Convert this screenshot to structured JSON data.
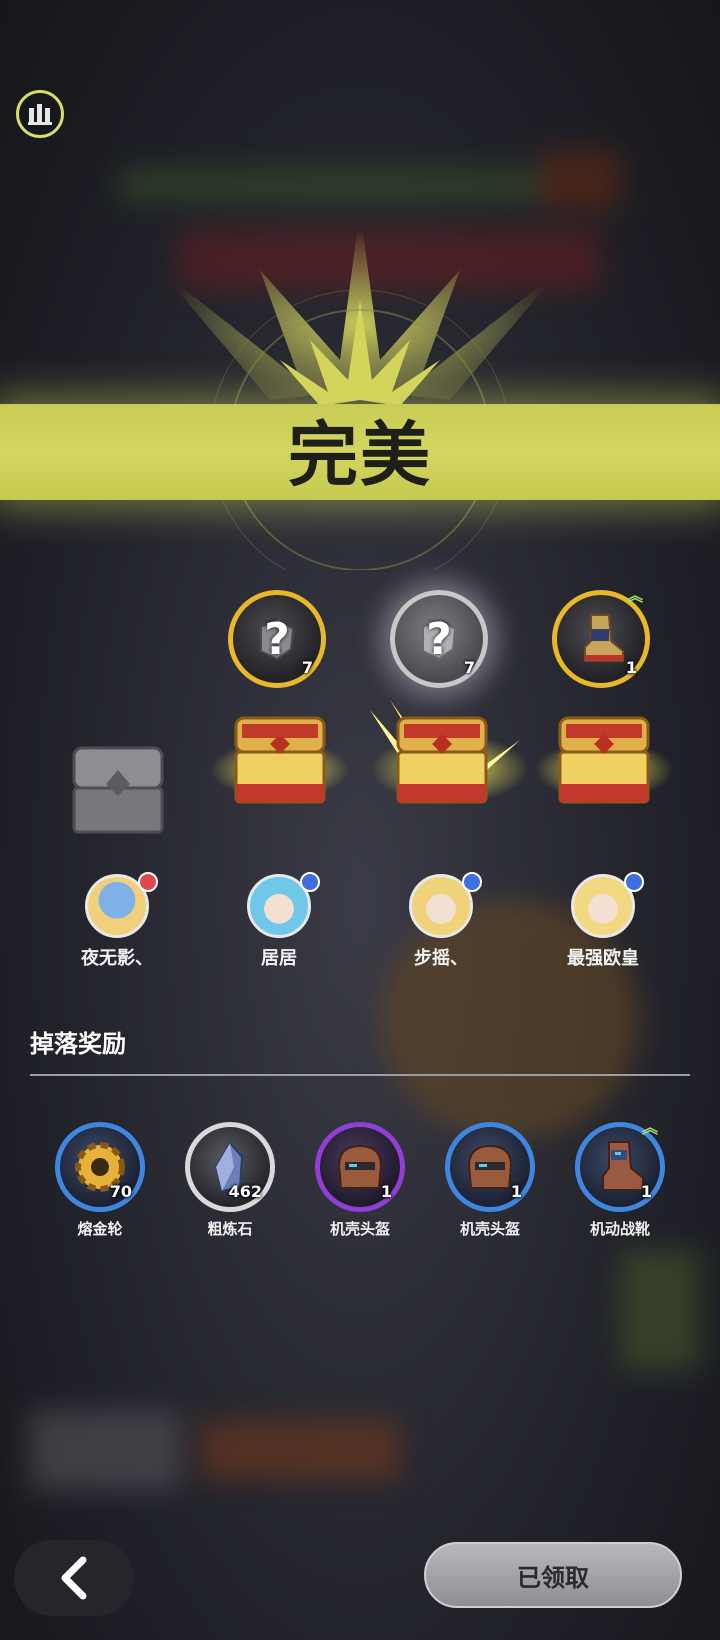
{
  "banner": {
    "title": "完美"
  },
  "rewards": [
    {
      "icon": "mystery-gear-icon",
      "count": "7",
      "state": "normal"
    },
    {
      "icon": "mystery-gear-icon",
      "count": "7",
      "state": "highlight"
    },
    {
      "icon": "mecha-boots-icon",
      "count": "1",
      "state": "normal",
      "upgrade": true
    }
  ],
  "players": [
    {
      "name": "夜无影、",
      "badge_color": "#e2474f"
    },
    {
      "name": "居居",
      "badge_color": "#3f6ee0"
    },
    {
      "name": "步摇、",
      "badge_color": "#3f6ee0"
    },
    {
      "name": "最强欧皇",
      "badge_color": "#3f6ee0"
    }
  ],
  "drops": {
    "title": "掉落奖励",
    "items": [
      {
        "name": "熔金轮",
        "count": "70",
        "rarity": "blue",
        "icon": "gold-gear-icon"
      },
      {
        "name": "粗炼石",
        "count": "462",
        "rarity": "white",
        "icon": "crystal-ore-icon"
      },
      {
        "name": "机壳头盔",
        "count": "1",
        "rarity": "purple",
        "icon": "helmet-icon"
      },
      {
        "name": "机壳头盔",
        "count": "1",
        "rarity": "blue",
        "icon": "helmet-icon"
      },
      {
        "name": "机动战靴",
        "count": "1",
        "rarity": "blue",
        "icon": "mecha-boots-icon",
        "upgrade": true
      }
    ]
  },
  "footer": {
    "claim_label": "已领取"
  },
  "colors": {
    "banner": "#d3d65f",
    "gold": "#e8b72a",
    "blue_rarity": "#3e86e0",
    "purple_rarity": "#8f3fd4"
  }
}
